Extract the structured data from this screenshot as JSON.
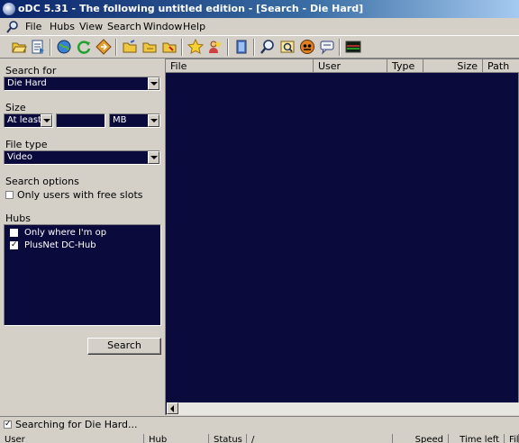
{
  "window": {
    "title": "oDC 5.31 - The following untitled edition - [Search - Die Hard]"
  },
  "menu": [
    "File",
    "Hubs",
    "View",
    "Search",
    "Window",
    "Help"
  ],
  "toolbar": {
    "icons": [
      "open-folder-icon",
      "open-list-icon",
      "globe-icon",
      "refresh-icon",
      "reconnect-icon",
      "folder-icon",
      "folder-icon",
      "folder-icon",
      "favorites-star-icon",
      "users-icon",
      "notepad-icon",
      "search-icon",
      "search-spy-icon",
      "adl-icon",
      "chat-icon",
      "network-stats-icon"
    ]
  },
  "search_panel": {
    "search_for_label": "Search for",
    "search_value": "Die Hard",
    "size_label": "Size",
    "size_mode": "At least",
    "size_value": "",
    "size_unit": "MB",
    "file_type_label": "File type",
    "file_type_value": "Video",
    "search_options_label": "Search options",
    "free_slots_label": "Only users with free slots",
    "free_slots_checked": false,
    "hubs_label": "Hubs",
    "hubs": [
      {
        "label": "Only where I'm op",
        "checked": false
      },
      {
        "label": "PlusNet DC-Hub",
        "checked": true
      }
    ],
    "search_button": "Search"
  },
  "results": {
    "columns": [
      "File",
      "User",
      "Type",
      "Size",
      "Path"
    ]
  },
  "status": {
    "checked": true,
    "text": "Searching for Die Hard..."
  },
  "transfers": {
    "columns": [
      "User",
      "Hub",
      "Status",
      "/",
      "Speed",
      "Time left",
      "File"
    ]
  },
  "colors": {
    "list_background": "#0a0a3c",
    "title_gradient_start": "#0a246a",
    "title_gradient_end": "#a6caf0"
  }
}
